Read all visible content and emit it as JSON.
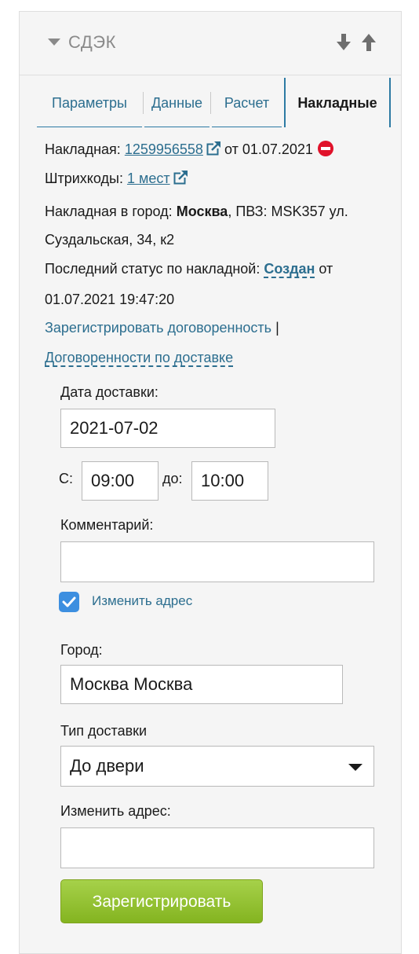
{
  "header": {
    "title": "СДЭК"
  },
  "tabs": [
    {
      "label": "Параметры"
    },
    {
      "label": "Данные"
    },
    {
      "label": "Расчет"
    },
    {
      "label": "Накладные"
    }
  ],
  "invoice": {
    "label": "Накладная:",
    "number": "1259956558",
    "date_text": "от 01.07.2021"
  },
  "barcodes": {
    "label": "Штрихкоды:",
    "link": "1 мест"
  },
  "city_line": {
    "prefix": "Накладная в город:",
    "city": "Москва",
    "rest": ", ПВЗ: MSK357 ул.",
    "line2": "Суздальская, 34, к2"
  },
  "status": {
    "prefix": "Последний статус по накладной:",
    "value": "Создан",
    "suffix": "от",
    "datetime": "01.07.2021 19:47:20"
  },
  "links": {
    "register_agreement": "Зарегистрировать договоренность",
    "separator": "|",
    "delivery_agreements": "Договоренности по доставке"
  },
  "form": {
    "delivery_date_label": "Дата доставки:",
    "delivery_date_value": "2021-07-02",
    "from_label": "С:",
    "from_value": "09:00",
    "to_label": "до:",
    "to_value": "10:00",
    "comment_label": "Комментарий:",
    "comment_value": "",
    "change_address_checkbox_label": "Изменить адрес",
    "change_address_checked": true,
    "city_label": "Город:",
    "city_value": "Москва Москва",
    "delivery_type_label": "Тип доставки",
    "delivery_type_value": "До двери",
    "change_address_label": "Изменить адрес:",
    "change_address_value": "",
    "submit_label": "Зарегистрировать"
  },
  "colors": {
    "link": "#2c6e8f",
    "checkbox": "#3d8fe0",
    "button": "#9ac63a",
    "stop_icon": "#e0122a"
  }
}
